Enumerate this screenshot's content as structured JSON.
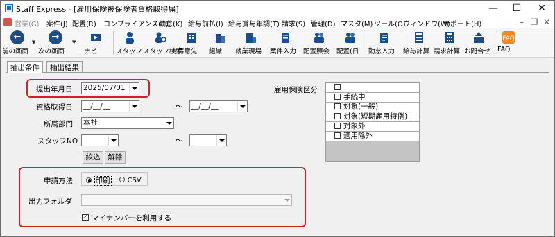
{
  "window": {
    "title": "Staff Express - [雇用保険被保険者資格取得届]",
    "minimize_glyph": "—",
    "maximize_glyph": "☐",
    "close_glyph": "✕"
  },
  "menubar": {
    "items": [
      {
        "label": "営業(G)",
        "disabled": true
      },
      {
        "label": "案件(J)",
        "disabled": false
      },
      {
        "label": "配置(R)",
        "disabled": false
      },
      {
        "label": "コンプライアンス(C)",
        "disabled": false
      },
      {
        "label": "勤怠(K)",
        "disabled": false
      },
      {
        "label": "給与前払(I)",
        "disabled": false
      },
      {
        "label": "給与賞与年調(T)",
        "disabled": false
      },
      {
        "label": "請求(S)",
        "disabled": false
      },
      {
        "label": "管理(D)",
        "disabled": false
      },
      {
        "label": "マスタ(M)",
        "disabled": false
      },
      {
        "label": "ツール(O)",
        "disabled": false
      },
      {
        "label": "ウィンドウ(W)",
        "disabled": false
      },
      {
        "label": "サポート(H)",
        "disabled": false
      }
    ],
    "mdi_minimize": "–",
    "mdi_restore": "❐",
    "mdi_close": "✕"
  },
  "toolbar": {
    "items": [
      {
        "label": "前の画面",
        "icon": "back-arrow-icon"
      },
      {
        "label": "次の画面",
        "icon": "forward-arrow-icon"
      },
      {
        "label": "ナビ",
        "icon": "navi-icon"
      },
      {
        "label": "スタッフ",
        "icon": "staff-icon"
      },
      {
        "label": "スタッフ検索",
        "icon": "staff-search-icon"
      },
      {
        "label": "得意先",
        "icon": "client-icon"
      },
      {
        "label": "組織",
        "icon": "organization-icon"
      },
      {
        "label": "就業現場",
        "icon": "worksite-icon"
      },
      {
        "label": "案件入力",
        "icon": "job-entry-icon"
      },
      {
        "label": "配置照会",
        "icon": "placement-inquiry-icon"
      },
      {
        "label": "配置(日",
        "icon": "placement-daily-icon"
      },
      {
        "label": "勤怠入力",
        "icon": "attendance-entry-icon"
      },
      {
        "label": "給与計算",
        "icon": "payroll-calc-icon"
      },
      {
        "label": "請求計算",
        "icon": "billing-calc-icon"
      },
      {
        "label": "お問合せ",
        "icon": "inquiry-icon"
      },
      {
        "label": "FAQ",
        "icon": "faq-icon"
      }
    ],
    "faq_badge": "FAQ"
  },
  "tabs": [
    {
      "label": "抽出条件",
      "active": true
    },
    {
      "label": "抽出結果",
      "active": false
    }
  ],
  "form": {
    "submit_date_label": "提出年月日",
    "submit_date_value": "2025/07/01",
    "acquire_date_label": "資格取得日",
    "acquire_date_from": "__/__/__",
    "acquire_date_to": "__/__/__",
    "tilde": "～",
    "department_label": "所属部門",
    "department_value": "本社",
    "staff_no_label": "スタッフNO",
    "staff_no_from": "",
    "staff_no_to": "",
    "filter_button": "絞込",
    "clear_button": "解除",
    "insurance_label": "雇用保険区分",
    "insurance_options": [
      {
        "label": "",
        "checked": false
      },
      {
        "label": "手続中",
        "checked": false
      },
      {
        "label": "対象(一般)",
        "checked": false
      },
      {
        "label": "対象(短期雇用特例)",
        "checked": false
      },
      {
        "label": "対象外",
        "checked": false
      },
      {
        "label": "適用除外",
        "checked": false
      }
    ],
    "apply_method_label": "申請方法",
    "apply_method_options": [
      {
        "label": "印刷",
        "selected": true
      },
      {
        "label": "CSV",
        "selected": false
      }
    ],
    "output_folder_label": "出力フォルダ",
    "output_folder_value": "",
    "mynumber_label": "マイナンバーを利用する",
    "mynumber_checked": true,
    "check_mark": "✓"
  },
  "colors": {
    "highlight_border": "#d0202a",
    "toolbar_icon_blue": "#1b4c8c",
    "faq_orange": "#f08a24"
  }
}
